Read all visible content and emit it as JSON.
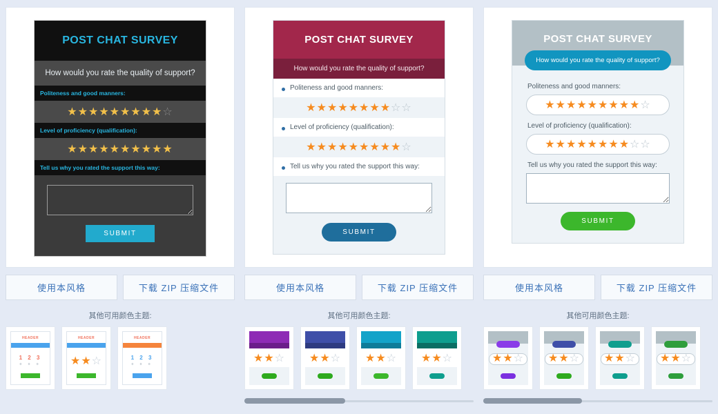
{
  "page": {
    "background_color": "#e4eaf5"
  },
  "columns": [
    {
      "theme_key": "dark",
      "widget": {
        "title": "POST CHAT SURVEY",
        "subtitle": "How would you rate the quality of support?",
        "questions": [
          {
            "label": "Politeness and good manners:",
            "stars_filled": 9,
            "stars_total": 10
          },
          {
            "label": "Level of proficiency (qualification):",
            "stars_filled": 10,
            "stars_total": 10
          }
        ],
        "comment_label": "Tell us why you rated the support this way:",
        "comment_value": "",
        "comment_placeholder": "",
        "submit_label": "SUBMIT",
        "colors": {
          "header_bg": "#101010",
          "header_text": "#29b6e0",
          "body_bg": "#3b3b3b",
          "submit_bg": "#22aacd",
          "star_on": "#f2c04a",
          "star_off": "#8d8d8d"
        }
      },
      "actions": {
        "use_style": "使用本风格",
        "download_zip": "下载 ZIP 压缩文件"
      },
      "themes_label": "其他可用颜色主题:",
      "thumb_variant": "A",
      "thumbs": [
        {
          "title": "HEADER",
          "title_color": "#f0705a",
          "bar_color": "#4aa3ed",
          "nums": "1 2 3",
          "nums_color": "#f0705a",
          "dots": "o o o",
          "button_color": "#3cb72c",
          "show_stars": false
        },
        {
          "title": "HEADER",
          "title_color": "#f0705a",
          "bar_color": "#4aa3ed",
          "stars_filled": 2,
          "stars_total": 3,
          "button_color": "#3cb72c",
          "show_stars": true
        },
        {
          "title": "HEADER",
          "title_color": "#f0705a",
          "bar_color": "#f5843c",
          "nums": "1 2 3",
          "nums_color": "#4aa3ed",
          "dots": "o o o",
          "button_color": "#4aa3ed",
          "show_stars": false
        }
      ],
      "scrollbar": {
        "visible": false,
        "thumb_percent": 0
      }
    },
    {
      "theme_key": "crimson",
      "widget": {
        "title": "POST CHAT SURVEY",
        "subtitle": "How would you rate the quality of support?",
        "questions": [
          {
            "label": "Politeness and good manners:",
            "stars_filled": 8,
            "stars_total": 10
          },
          {
            "label": "Level of proficiency (qualification):",
            "stars_filled": 9,
            "stars_total": 10
          }
        ],
        "comment_label": "Tell us why you rated the support this way:",
        "comment_value": "",
        "comment_placeholder": "",
        "submit_label": "SUBMIT",
        "colors": {
          "header_bg": "#a2274b",
          "subheader_bg": "#7a1f3c",
          "body_bg": "#eef3f7",
          "submit_bg": "#1f6e9c",
          "star_on": "#f68b1f",
          "star_off": "#b9c4cc"
        }
      },
      "actions": {
        "use_style": "使用本风格",
        "download_zip": "下载 ZIP 压缩文件"
      },
      "themes_label": "其他可用颜色主题:",
      "thumb_variant": "B",
      "thumbs": [
        {
          "head_color": "#8e2bb5",
          "subhead_color": "#6b1d8a",
          "stars_filled": 2,
          "stars_total": 3,
          "button_color": "#2eaa1e"
        },
        {
          "head_color": "#3f4fa8",
          "subhead_color": "#2e3b80",
          "stars_filled": 2,
          "stars_total": 3,
          "button_color": "#2eaa1e"
        },
        {
          "head_color": "#13a3c9",
          "subhead_color": "#0e7c99",
          "stars_filled": 2,
          "stars_total": 3,
          "button_color": "#3cb72c"
        },
        {
          "head_color": "#0e9e8e",
          "subhead_color": "#0a6e63",
          "stars_filled": 2,
          "stars_total": 3,
          "button_color": "#0e9e8e"
        }
      ],
      "scrollbar": {
        "visible": true,
        "thumb_percent": 44
      }
    },
    {
      "theme_key": "gray",
      "widget": {
        "title": "POST CHAT SURVEY",
        "subtitle": "How would you rate the quality of support?",
        "questions": [
          {
            "label": "Politeness and good manners:",
            "stars_filled": 9,
            "stars_total": 10
          },
          {
            "label": "Level of proficiency (qualification):",
            "stars_filled": 8,
            "stars_total": 10
          }
        ],
        "comment_label": "Tell us why you rated the support this way:",
        "comment_value": "",
        "comment_placeholder": "",
        "submit_label": "SUBMIT",
        "colors": {
          "header_bg": "#b3c0c6",
          "pill_bg": "#1195c0",
          "body_bg": "#eef3f7",
          "submit_bg": "#3cb72c",
          "star_on": "#f68b1f",
          "star_off": "#b9c4cc"
        }
      },
      "actions": {
        "use_style": "使用本风格",
        "download_zip": "下载 ZIP 压缩文件"
      },
      "themes_label": "其他可用颜色主题:",
      "thumb_variant": "C",
      "thumbs": [
        {
          "pill_color": "#8a3ce8",
          "stars_filled": 2,
          "stars_total": 3,
          "button_color": "#7b2fe0"
        },
        {
          "pill_color": "#3f4fa8",
          "stars_filled": 2,
          "stars_total": 3,
          "button_color": "#2eaa1e"
        },
        {
          "pill_color": "#0e9e8e",
          "stars_filled": 2,
          "stars_total": 3,
          "button_color": "#0e9e8e"
        },
        {
          "pill_color": "#2f9e3c",
          "stars_filled": 2,
          "stars_total": 3,
          "button_color": "#2e9e3c"
        }
      ],
      "scrollbar": {
        "visible": true,
        "thumb_percent": 43
      }
    }
  ]
}
